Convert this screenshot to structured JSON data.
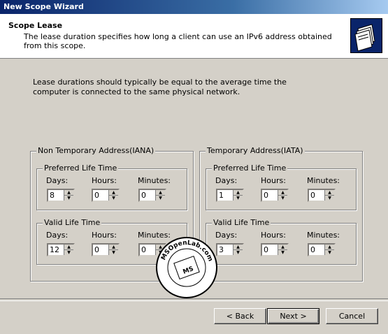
{
  "window": {
    "title": "New Scope Wizard"
  },
  "header": {
    "title": "Scope Lease",
    "description": "The lease duration specifies how long a client can use an IPv6 address obtained from this scope."
  },
  "intro": "Lease durations should typically be equal to the average time the computer is connected to the same physical network.",
  "iana": {
    "legend": "Non Temporary Address(IANA)",
    "preferred": {
      "legend": "Preferred Life Time",
      "days_label": "Days:",
      "hours_label": "Hours:",
      "minutes_label": "Minutes:",
      "days": "8",
      "hours": "0",
      "minutes": "0"
    },
    "valid": {
      "legend": "Valid Life Time",
      "days_label": "Days:",
      "hours_label": "Hours:",
      "minutes_label": "Minutes:",
      "days": "12",
      "hours": "0",
      "minutes": "0"
    }
  },
  "iata": {
    "legend": "Temporary Address(IATA)",
    "preferred": {
      "legend": "Preferred Life Time",
      "days_label": "Days:",
      "hours_label": "Hours:",
      "minutes_label": "Minutes:",
      "days": "1",
      "hours": "0",
      "minutes": "0"
    },
    "valid": {
      "legend": "Valid Life Time",
      "days_label": "Days:",
      "hours_label": "Hours:",
      "minutes_label": "Minutes:",
      "days": "3",
      "hours": "0",
      "minutes": "0"
    }
  },
  "buttons": {
    "back": "< Back",
    "next": "Next >",
    "cancel": "Cancel"
  },
  "watermark": {
    "text": "MSOpenLab.com",
    "badge": "MS"
  }
}
